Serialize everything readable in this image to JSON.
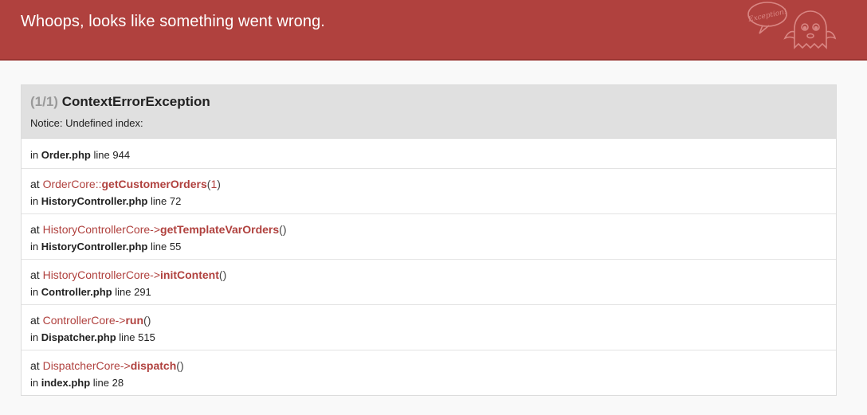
{
  "header": {
    "title": "Whoops, looks like something went wrong.",
    "ghost_badge": "Exception!"
  },
  "exception": {
    "count": "(1/1)",
    "name": "ContextErrorException",
    "message": "Notice: Undefined index:",
    "origin": {
      "in": "in",
      "file": "Order.php",
      "line_word": "line",
      "line": "944"
    }
  },
  "frames": [
    {
      "at": "at",
      "class": "OrderCore",
      "operator": "::",
      "function": "getCustomerOrders",
      "open": "(",
      "args": "1",
      "close": ")",
      "in": "in",
      "file": "HistoryController.php",
      "line_word": "line",
      "line": "72"
    },
    {
      "at": "at",
      "class": "HistoryControllerCore",
      "operator": "->",
      "function": "getTemplateVarOrders",
      "open": "(",
      "args": "",
      "close": ")",
      "in": "in",
      "file": "HistoryController.php",
      "line_word": "line",
      "line": "55"
    },
    {
      "at": "at",
      "class": "HistoryControllerCore",
      "operator": "->",
      "function": "initContent",
      "open": "(",
      "args": "",
      "close": ")",
      "in": "in",
      "file": "Controller.php",
      "line_word": "line",
      "line": "291"
    },
    {
      "at": "at",
      "class": "ControllerCore",
      "operator": "->",
      "function": "run",
      "open": "(",
      "args": "",
      "close": ")",
      "in": "in",
      "file": "Dispatcher.php",
      "line_word": "line",
      "line": "515"
    },
    {
      "at": "at",
      "class": "DispatcherCore",
      "operator": "->",
      "function": "dispatch",
      "open": "(",
      "args": "",
      "close": ")",
      "in": "in",
      "file": "index.php",
      "line_word": "line",
      "line": "28"
    }
  ],
  "colors": {
    "header_bg": "#b0413e",
    "accent": "#b0413e",
    "panel_head_bg": "#e0e0e0",
    "page_bg": "#f9f9f9"
  },
  "icons": {
    "mascot": "ghost-exception-icon"
  }
}
